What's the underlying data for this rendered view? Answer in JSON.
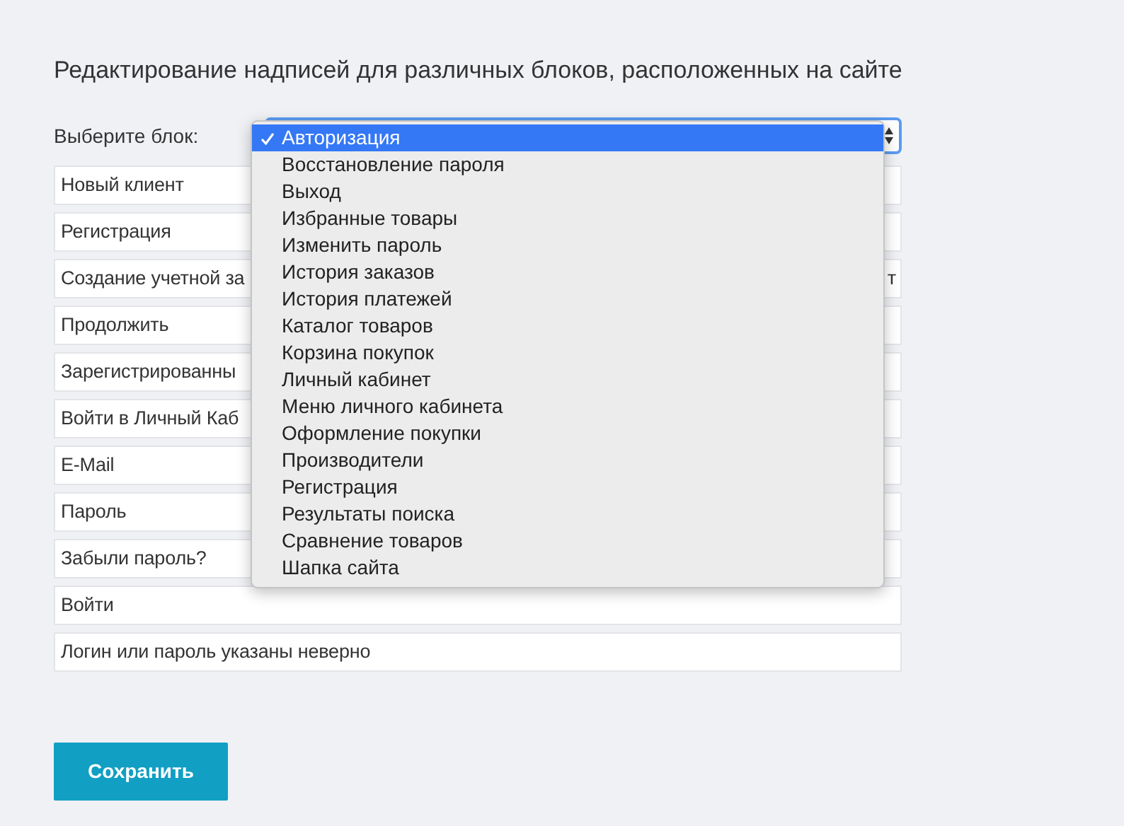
{
  "title": "Редактирование надписей для различных блоков, расположенных на сайте",
  "block_select": {
    "label": "Выберите блок:",
    "expanded": true,
    "options": [
      {
        "label": "Авторизация",
        "selected": true
      },
      {
        "label": "Восстановление пароля",
        "selected": false
      },
      {
        "label": "Выход",
        "selected": false
      },
      {
        "label": "Избранные товары",
        "selected": false
      },
      {
        "label": "Изменить пароль",
        "selected": false
      },
      {
        "label": "История заказов",
        "selected": false
      },
      {
        "label": "История платежей",
        "selected": false
      },
      {
        "label": "Каталог товаров",
        "selected": false
      },
      {
        "label": "Корзина покупок",
        "selected": false
      },
      {
        "label": "Личный кабинет",
        "selected": false
      },
      {
        "label": "Меню личного кабинета",
        "selected": false
      },
      {
        "label": "Оформление покупки",
        "selected": false
      },
      {
        "label": "Производители",
        "selected": false
      },
      {
        "label": "Регистрация",
        "selected": false
      },
      {
        "label": "Результаты поиска",
        "selected": false
      },
      {
        "label": "Сравнение товаров",
        "selected": false
      },
      {
        "label": "Шапка сайта",
        "selected": false
      }
    ]
  },
  "fields": [
    {
      "value": "Новый клиент"
    },
    {
      "value": "Регистрация"
    },
    {
      "value": "Создание учетной за",
      "value_end": "т"
    },
    {
      "value": "Продолжить"
    },
    {
      "value": "Зарегистрированны"
    },
    {
      "value": "Войти в Личный Каб"
    },
    {
      "value": "E-Mail"
    },
    {
      "value": "Пароль"
    },
    {
      "value": "Забыли пароль?"
    },
    {
      "value": "Войти"
    },
    {
      "value": "Логин или пароль указаны неверно"
    }
  ],
  "save_button": "Сохранить"
}
